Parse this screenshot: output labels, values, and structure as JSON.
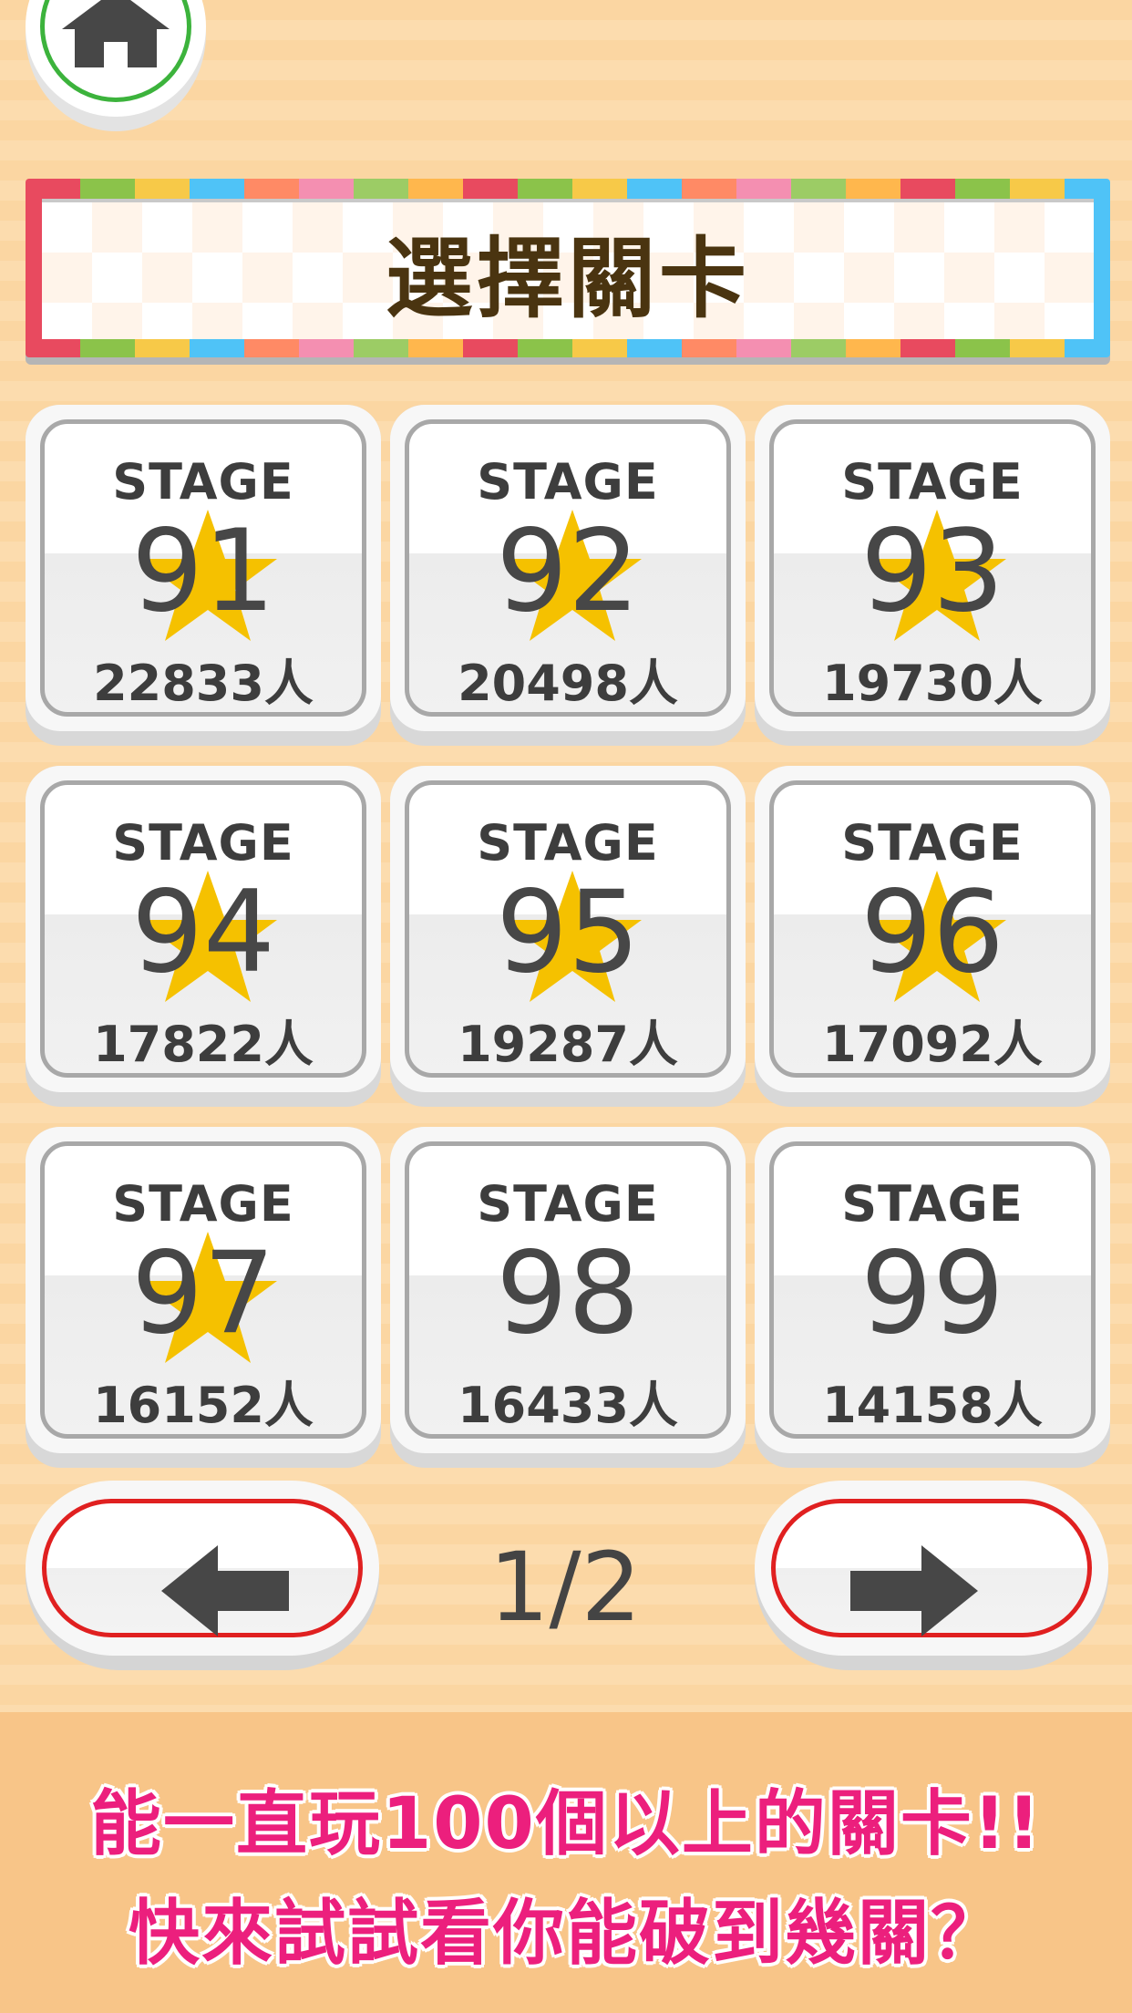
{
  "header": {
    "home_icon": "home-icon",
    "title": "選擇關卡"
  },
  "stages": [
    {
      "label": "STAGE",
      "number": "91",
      "count": "22833人",
      "starred": true
    },
    {
      "label": "STAGE",
      "number": "92",
      "count": "20498人",
      "starred": true
    },
    {
      "label": "STAGE",
      "number": "93",
      "count": "19730人",
      "starred": true
    },
    {
      "label": "STAGE",
      "number": "94",
      "count": "17822人",
      "starred": true
    },
    {
      "label": "STAGE",
      "number": "95",
      "count": "19287人",
      "starred": true
    },
    {
      "label": "STAGE",
      "number": "96",
      "count": "17092人",
      "starred": true
    },
    {
      "label": "STAGE",
      "number": "97",
      "count": "16152人",
      "starred": true
    },
    {
      "label": "STAGE",
      "number": "98",
      "count": "16433人",
      "starred": false
    },
    {
      "label": "STAGE",
      "number": "99",
      "count": "14158人",
      "starred": false
    }
  ],
  "pagination": {
    "prev_icon": "arrow-left-icon",
    "next_icon": "arrow-right-icon",
    "page": "1/2"
  },
  "caption": {
    "line1": "能一直玩100個以上的關卡!!",
    "line2": "快來試試看你能破到幾關？"
  },
  "colors": {
    "background": "#fbd9a8",
    "title_text": "#4a3410",
    "star": "#f5c100",
    "caption_text": "#ec1f7d",
    "nav_ring": "#e02020",
    "home_ring": "#3cb33c"
  }
}
